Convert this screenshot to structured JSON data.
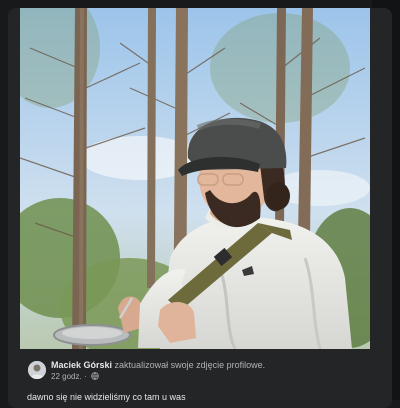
{
  "post": {
    "author": "Maciek Górski",
    "action": "zaktualizował swoje zdjęcie profilowe.",
    "time": "22 godz.",
    "separator": "·",
    "caption": "dawno się nie widzieliśmy co tam u was"
  },
  "icons": {
    "privacy": "globe-icon",
    "avatar": "profile-avatar"
  },
  "colors": {
    "background": "#18191a",
    "card": "#242526",
    "text": "#e4e6eb",
    "secondary": "#b0b3b8"
  }
}
